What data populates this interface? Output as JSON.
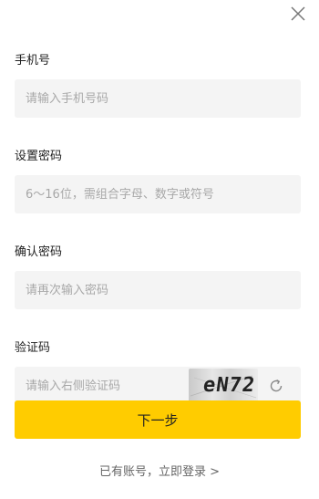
{
  "phone": {
    "label": "手机号",
    "placeholder": "请输入手机号码",
    "value": ""
  },
  "password": {
    "label": "设置密码",
    "placeholder": "6～16位，需组合字母、数字或符号",
    "value": ""
  },
  "confirm_password": {
    "label": "确认密码",
    "placeholder": "请再次输入密码",
    "value": ""
  },
  "captcha": {
    "label": "验证码",
    "placeholder": "请输入右侧验证码",
    "value": "",
    "image_text": "eN72"
  },
  "submit_label": "下一步",
  "login_link": "已有账号，立即登录 >",
  "icons": {
    "close": "close-icon",
    "refresh": "refresh-icon"
  },
  "colors": {
    "primary": "#ffcc00",
    "field_bg": "#f4f4f4",
    "placeholder": "#a8a8a8"
  }
}
